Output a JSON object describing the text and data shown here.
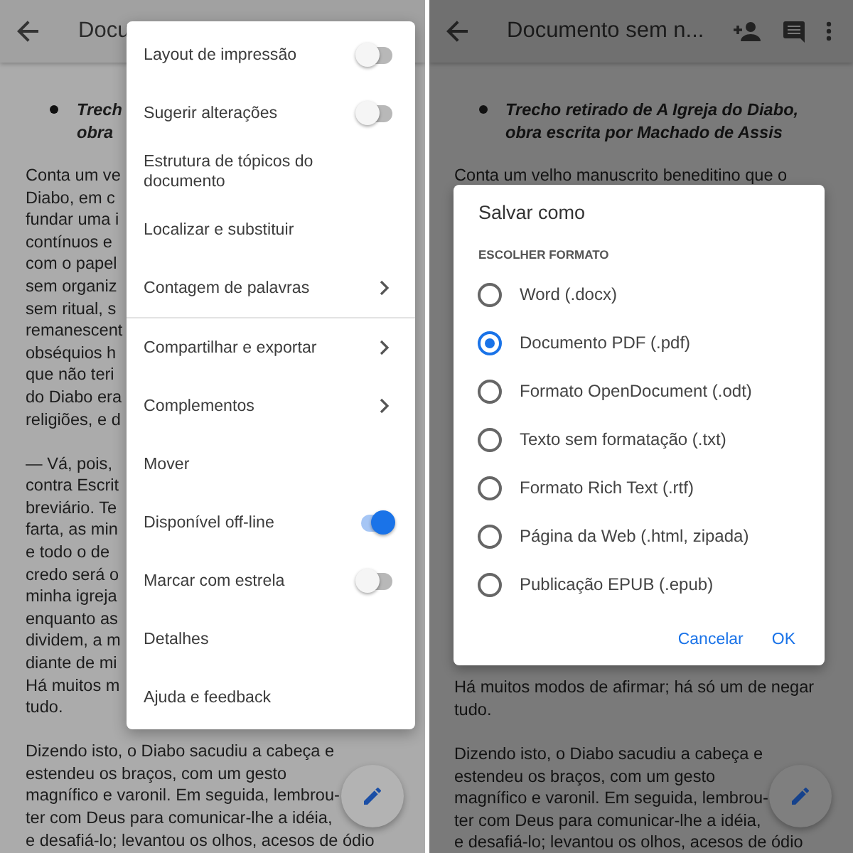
{
  "left_screen": {
    "app_bar": {
      "title": "Docu"
    },
    "document": {
      "bullet": [
        "Trech",
        "obra"
      ],
      "paragraphs": [
        [
          "Conta um ve",
          "Diabo, em c",
          "fundar uma i",
          "contínuos e",
          "com o papel",
          "sem organiz",
          "sem ritual, s",
          "remanescent",
          "obséquios h",
          "que não teri",
          "do Diabo era",
          "religiões, e d"
        ],
        [
          "— Vá, pois,",
          "contra Escrit",
          "breviário. Te",
          "farta, as min",
          "e todo o de",
          "credo será o",
          "minha igreja",
          "enquanto as",
          "dividem, a m",
          "diante de mi",
          "Há muitos m",
          "tudo."
        ],
        [
          "Dizendo isto, o Diabo sacudiu a cabeça e",
          "estendeu os braços, com um gesto",
          "magnífico e varonil. Em seguida, lembrou-",
          "ter com Deus para comunicar-lhe a idéia,",
          "e desafiá-lo; levantou os olhos, acesos de ódio"
        ]
      ]
    },
    "menu": {
      "sections": [
        [
          {
            "label": "Layout de impressão",
            "kind": "toggle",
            "on": false
          },
          {
            "label": "Sugerir alterações",
            "kind": "toggle",
            "on": false
          },
          {
            "label": "Estrutura de tópicos do documento",
            "kind": "plain"
          },
          {
            "label": "Localizar e substituir",
            "kind": "plain"
          },
          {
            "label": "Contagem de palavras",
            "kind": "submenu"
          }
        ],
        [
          {
            "label": "Compartilhar e exportar",
            "kind": "submenu"
          },
          {
            "label": "Complementos",
            "kind": "submenu"
          },
          {
            "label": "Mover",
            "kind": "plain"
          },
          {
            "label": "Disponível off-line",
            "kind": "toggle",
            "on": true
          },
          {
            "label": "Marcar com estrela",
            "kind": "toggle",
            "on": false
          },
          {
            "label": "Detalhes",
            "kind": "plain"
          },
          {
            "label": "Ajuda e feedback",
            "kind": "plain"
          }
        ]
      ]
    }
  },
  "right_screen": {
    "app_bar": {
      "title": "Documento sem n..."
    },
    "document": {
      "bullet": [
        "Trecho retirado de A Igreja do Diabo,",
        "obra escrita por Machado de Assis"
      ],
      "top_lines": [
        "Conta um velho manuscrito beneditino que o"
      ],
      "bottom_paragraphs": [
        [
          "Há muitos modos de afirmar; há só um de negar",
          "tudo."
        ],
        [
          "Dizendo isto, o Diabo sacudiu a cabeça e",
          "estendeu os braços, com um gesto",
          "magnífico e varonil. Em seguida, lembrou-",
          "ter com Deus para comunicar-lhe a idéia,",
          "e desafiá-lo; levantou os olhos, acesos de ódio"
        ]
      ]
    },
    "dialog": {
      "title": "Salvar como",
      "section_label": "ESCOLHER FORMATO",
      "options": [
        {
          "label": "Word (.docx)",
          "selected": false
        },
        {
          "label": "Documento PDF (.pdf)",
          "selected": true
        },
        {
          "label": "Formato OpenDocument (.odt)",
          "selected": false
        },
        {
          "label": "Texto sem formatação (.txt)",
          "selected": false
        },
        {
          "label": "Formato Rich Text (.rtf)",
          "selected": false
        },
        {
          "label": "Página da Web (.html, zipada)",
          "selected": false
        },
        {
          "label": "Publicação EPUB (.epub)",
          "selected": false
        }
      ],
      "buttons": [
        "Cancelar",
        "OK"
      ]
    }
  }
}
